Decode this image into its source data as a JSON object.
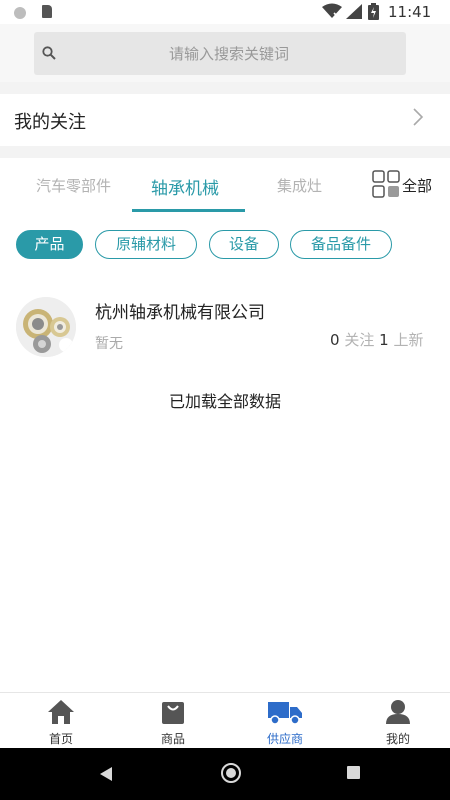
{
  "status_bar": {
    "time": "11:41",
    "icons": [
      "sim-dot-icon",
      "sd-card-icon",
      "wifi-icon",
      "signal-icon",
      "battery-icon"
    ]
  },
  "search": {
    "placeholder": "请输入搜索关键词",
    "icon": "search-icon"
  },
  "follow": {
    "title": "我的关注",
    "icon": "chevron-right-icon"
  },
  "tabs": {
    "items": [
      {
        "label": "汽车零部件",
        "active": false
      },
      {
        "label": "轴承机械",
        "active": true
      },
      {
        "label": "集成灶",
        "active": false
      }
    ],
    "all_label": "全部",
    "all_icon": "grid-icon"
  },
  "chips": [
    {
      "label": "产品",
      "active": true
    },
    {
      "label": "原辅材料",
      "active": false
    },
    {
      "label": "设备",
      "active": false
    },
    {
      "label": "备品备件",
      "active": false
    }
  ],
  "company": {
    "name": "杭州轴承机械有限公司",
    "description": "暂无",
    "follow_count": "0",
    "follow_label": "关注",
    "new_count": "1",
    "new_label": "上新"
  },
  "list_footer": "已加载全部数据",
  "bottom_nav": {
    "items": [
      {
        "label": "首页",
        "icon": "home-icon",
        "active": false
      },
      {
        "label": "商品",
        "icon": "shopping-bag-icon",
        "active": false
      },
      {
        "label": "供应商",
        "icon": "truck-icon",
        "active": true
      },
      {
        "label": "我的",
        "icon": "user-icon",
        "active": false
      }
    ]
  },
  "colors": {
    "accent": "#2a9aa8",
    "nav_active": "#2d6cc9",
    "muted_text": "#b3b3b3"
  }
}
